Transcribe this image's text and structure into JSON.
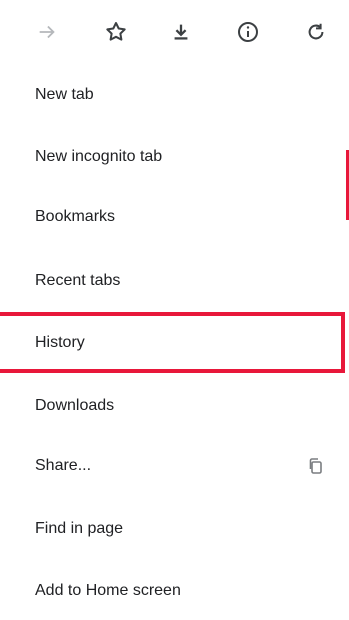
{
  "toolbar": {
    "icons": {
      "forward": "forward-arrow-icon",
      "bookmark": "star-icon",
      "download": "download-icon",
      "info": "info-icon",
      "refresh": "refresh-icon"
    }
  },
  "menu": {
    "items": [
      {
        "label": "New tab"
      },
      {
        "label": "New incognito tab"
      },
      {
        "label": "Bookmarks"
      },
      {
        "label": "Recent tabs"
      },
      {
        "label": "History"
      },
      {
        "label": "Downloads"
      },
      {
        "label": "Share..."
      },
      {
        "label": "Find in page"
      },
      {
        "label": "Add to Home screen"
      }
    ]
  },
  "highlight": {
    "target": "History",
    "color": "#e8173a"
  }
}
